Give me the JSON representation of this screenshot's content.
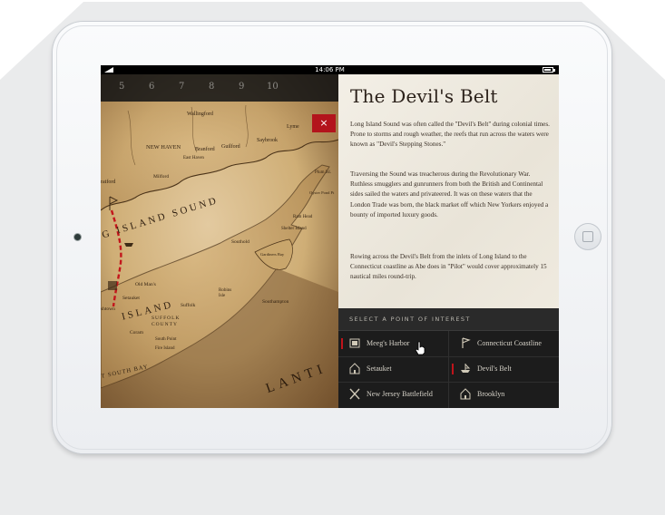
{
  "device": {
    "status_time": "14:06 PM"
  },
  "nav": {
    "pages": [
      "5",
      "6",
      "7",
      "8",
      "9",
      "10"
    ],
    "close_label": "×"
  },
  "map": {
    "labels": {
      "wallingford": "Wallingford",
      "new_haven": "NEW HAVEN",
      "branford": "Branford",
      "guilford": "Guilford",
      "saybrook": "Saybrook",
      "lyme": "Lyme",
      "east_haven": "East Haven",
      "milford": "Milford",
      "stratford": "ratford",
      "long_island_sound": "G ISLAND SOUND",
      "plum_isl": "Plum Isl.",
      "oyster_pond_pt": "Oyster Pond Pt",
      "ram_head": "Ram Head",
      "southold": "Southold",
      "shelter_island": "Shelter Island",
      "gardiners_bay": "Gardiners Bay",
      "old_mans": "Old Man's",
      "setauket": "Setauket",
      "shtown": "shtown",
      "island": "ISLAND",
      "suffolk": "Suffolk",
      "suffolk_county": "SUFFOLK COUNTY",
      "coram": "Coram",
      "robins_isle": "Robins Isle",
      "southampton": "Southampton",
      "south_point": "South Point",
      "fire_island": "Fire Island",
      "south_bay": "T SOUTH BAY",
      "atlantic": "LANTI"
    }
  },
  "article": {
    "title": "The Devil's Belt",
    "paragraphs": [
      "Long Island Sound was often called the \"Devil's Belt\" during colonial times.  Prone to storms and rough weather, the reefs that run across the waters were known as \"Devil's Stepping Stones.\"",
      "Traversing the Sound was treacherous during the Revolutionary War. Ruthless smugglers and gunrunners from both the British and Continental sides sailed the waters and privateered. It was on these waters that the London Trade was born, the black market off which New Yorkers enjoyed a bounty of imported luxury goods.",
      "Rowing across the Devil's Belt from the inlets of Long Island to the Connecticut coastline as Abe does in \"Pilot\" would cover approximately 15 nautical miles round-trip."
    ]
  },
  "poi": {
    "header": "SELECT A POINT OF INTEREST",
    "items": [
      {
        "label": "Meeg's Harbor",
        "icon": "harbor-icon"
      },
      {
        "label": "Connecticut Coastline",
        "icon": "flag-icon"
      },
      {
        "label": "Setauket",
        "icon": "house-icon"
      },
      {
        "label": "Devil's Belt",
        "icon": "boat-icon"
      },
      {
        "label": "New Jersey Battlefield",
        "icon": "crossed-swords-icon"
      },
      {
        "label": "Brooklyn",
        "icon": "house-icon"
      }
    ],
    "accent_color": "#c0141b"
  },
  "colors": {
    "map_parchment": "#d9bf8a",
    "route": "#c3161c",
    "panel_dark": "#1c1c1c"
  }
}
